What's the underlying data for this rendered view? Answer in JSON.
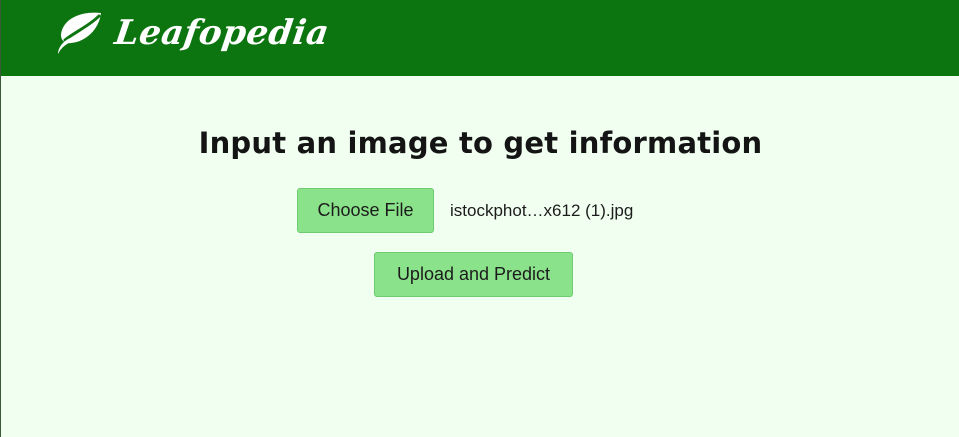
{
  "header": {
    "brand_name": "Leafopedia",
    "logo_icon": "leaf-icon",
    "background_color": "#0c7510"
  },
  "main": {
    "heading": "Input an image to get information",
    "file_input": {
      "button_label": "Choose File",
      "selected_file": "istockphot…x612 (1).jpg"
    },
    "upload_button_label": "Upload and Predict",
    "button_color": "#8ae28a",
    "background_color": "#f1fff1"
  }
}
